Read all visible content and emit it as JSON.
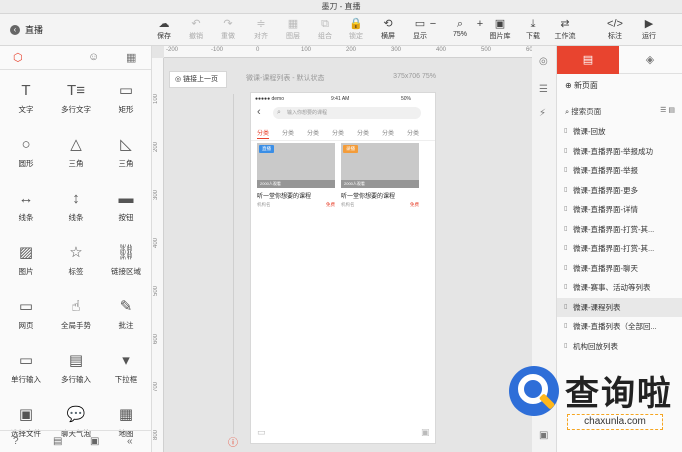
{
  "window": {
    "title": "墨刀 - 直播"
  },
  "toolbar": {
    "back_label": "直播",
    "save": "保存",
    "undo": "撤销",
    "redo": "重做",
    "align": "对齐",
    "layer": "图层",
    "group": "组合",
    "lock": "锁定",
    "flip": "横屏",
    "display": "显示",
    "zoom": "75%",
    "images": "图片库",
    "download": "下载",
    "workflow": "工作流",
    "mark": "标注",
    "run": "运行"
  },
  "left_panel": {
    "components": [
      "文字",
      "多行文字",
      "矩形",
      "圆形",
      "三角",
      "三角",
      "线条",
      "线条",
      "按钮",
      "图片",
      "标签",
      "链接区域",
      "网页",
      "全局手势",
      "批注",
      "单行输入",
      "多行输入",
      "下拉框",
      "选择文件",
      "聊天气泡",
      "地图"
    ],
    "component_icons": [
      "text-icon",
      "multiline-text-icon",
      "rectangle-icon",
      "circle-icon",
      "triangle-icon",
      "right-triangle-icon",
      "horizontal-line-icon",
      "vertical-line-icon",
      "button-icon",
      "image-icon",
      "star-icon",
      "link-area-icon",
      "webpage-icon",
      "gesture-icon",
      "comment-icon",
      "single-input-icon",
      "multi-input-icon",
      "dropdown-icon",
      "file-picker-icon",
      "chat-bubble-icon",
      "map-icon"
    ]
  },
  "canvas": {
    "ruler_top": [
      "-200",
      "-100",
      "0",
      "100",
      "200",
      "300",
      "400",
      "500",
      "600"
    ],
    "ruler_left": [
      "100",
      "200",
      "300",
      "400",
      "500",
      "600",
      "700",
      "800"
    ],
    "link_prev": "链接上一页",
    "page_info": "微课-课程列表 - 默认状态",
    "page_size": "375x706 75%"
  },
  "phone": {
    "carrier": "●●●●● demo",
    "time": "9:41 AM",
    "battery": "50%",
    "search_placeholder": "输入你想要的课程",
    "categories": [
      "分类",
      "分类",
      "分类",
      "分类",
      "分类",
      "分类",
      "分类"
    ],
    "cards": [
      {
        "tag": "直播",
        "tag_color": "#3a8ee6",
        "caption": "2000人观看",
        "title": "听一堂你想要的课程",
        "org": "机构名",
        "price": "免费"
      },
      {
        "tag": "录播",
        "tag_color": "#f39c3a",
        "caption": "2000人观看",
        "title": "听一堂你想要的课程",
        "org": "机构名",
        "price": "免费"
      }
    ]
  },
  "right_panel": {
    "new_page": "新页面",
    "search_page": "搜索页面",
    "pages": [
      "微课-回放",
      "微课-直播界面-举报成功",
      "微课-直播界面-举报",
      "微课-直播界面-更多",
      "微课-直播界面-详情",
      "微课-直播界面-打赏-其...",
      "微课-直播界面-打赏-其...",
      "微课-直播界面-聊天",
      "微课-赛事、活动等列表",
      "微课-课程列表",
      "微课-直播列表（全部回...",
      "机构回放列表"
    ],
    "selected_index": 9
  },
  "watermark": {
    "brand": "查询啦",
    "url": "chaxunla.com"
  }
}
